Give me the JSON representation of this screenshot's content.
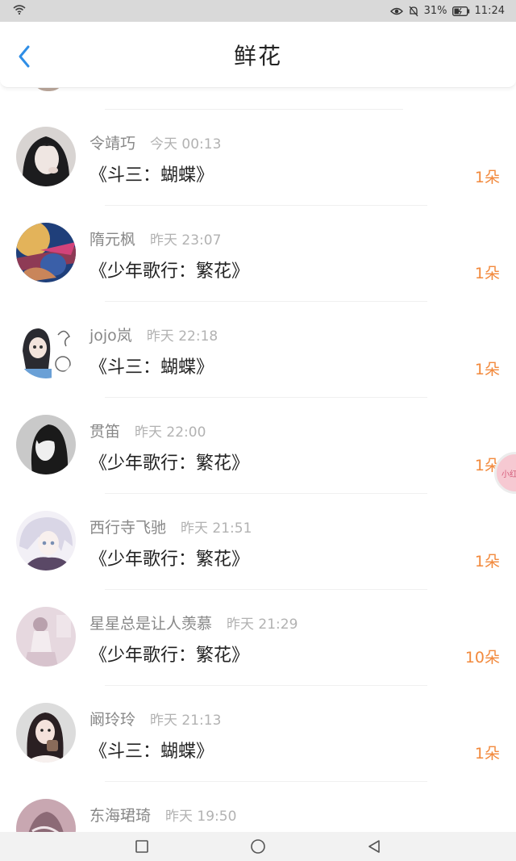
{
  "status_bar": {
    "battery": "31%",
    "time": "11:24"
  },
  "header": {
    "title": "鲜花"
  },
  "colors": {
    "accent": "#f2893c",
    "back": "#2f8ee6"
  },
  "entries": [
    {
      "name": "令靖巧",
      "time": "今天 00:13",
      "gift": "《斗三：蝴蝶》",
      "count": "1朵"
    },
    {
      "name": "隋元枫",
      "time": "昨天 23:07",
      "gift": "《少年歌行：繁花》",
      "count": "1朵"
    },
    {
      "name": "jojo岚",
      "time": "昨天 22:18",
      "gift": "《斗三：蝴蝶》",
      "count": "1朵"
    },
    {
      "name": "贯笛",
      "time": "昨天 22:00",
      "gift": "《少年歌行：繁花》",
      "count": "1朵"
    },
    {
      "name": "西行寺飞驰",
      "time": "昨天 21:51",
      "gift": "《少年歌行：繁花》",
      "count": "1朵"
    },
    {
      "name": "星星总是让人羡慕",
      "time": "昨天 21:29",
      "gift": "《少年歌行：繁花》",
      "count": "10朵"
    },
    {
      "name": "阚玲玲",
      "time": "昨天 21:13",
      "gift": "《斗三：蝴蝶》",
      "count": "1朵"
    },
    {
      "name": "东海珺琦",
      "time": "昨天 19:50",
      "gift": "",
      "count": ""
    }
  ],
  "floating_badge": {
    "label": "小红"
  }
}
